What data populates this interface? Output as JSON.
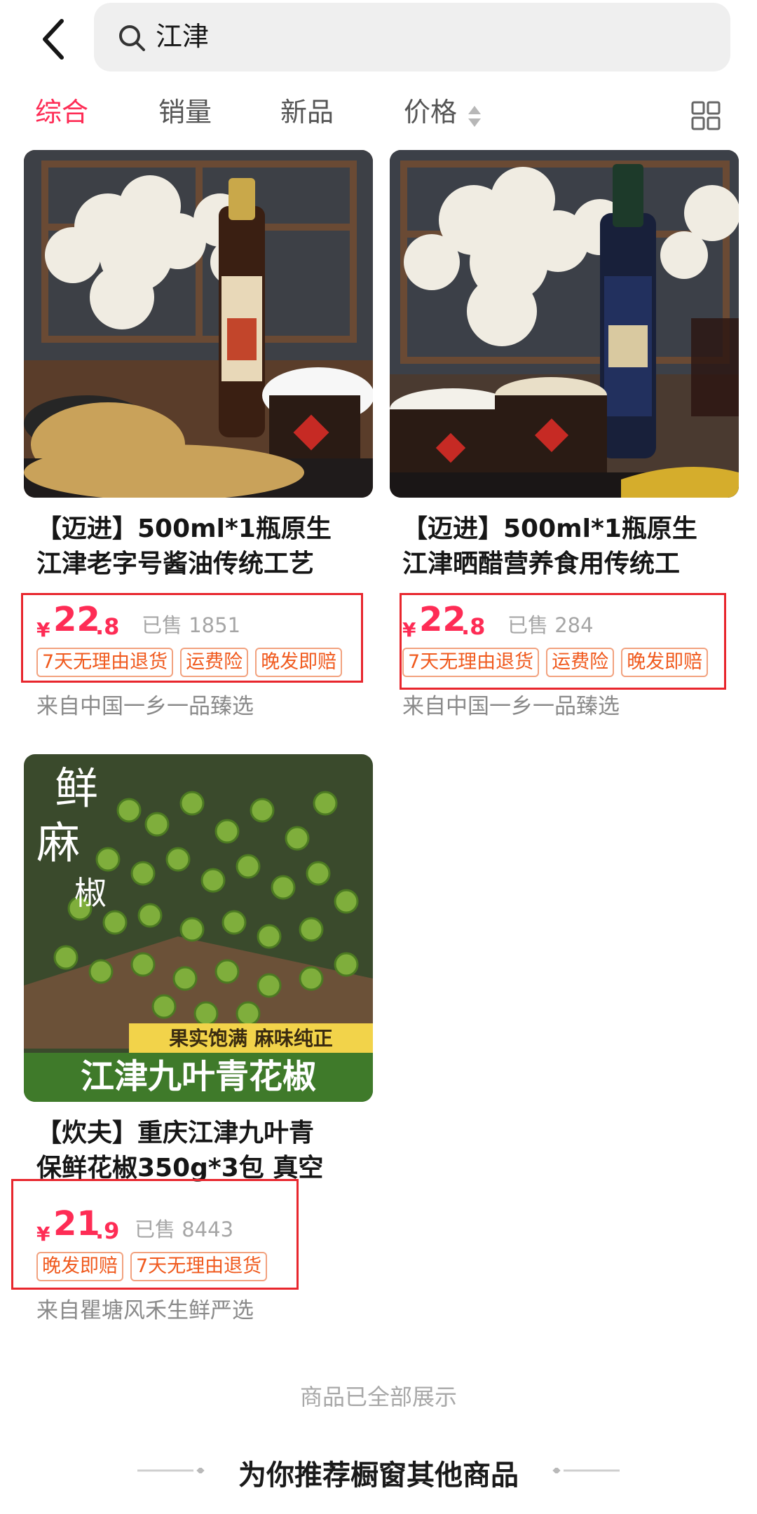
{
  "search": {
    "query": "江津"
  },
  "tabs": [
    {
      "label": "综合",
      "active": true
    },
    {
      "label": "销量",
      "active": false
    },
    {
      "label": "新品",
      "active": false
    },
    {
      "label": "价格",
      "active": false
    }
  ],
  "colors": {
    "accent": "#fe2c55",
    "tag": "#f05a1e",
    "highlight": "#e8262d"
  },
  "products": [
    {
      "title_line1": "【迈进】500ml*1瓶原生",
      "title_line2": "江津老字号酱油传统工艺",
      "currency": "¥",
      "price_int": "22",
      "price_dec": ".8",
      "sold": "已售 1851",
      "tags": [
        "7天无理由退货",
        "运费险",
        "晚发即赔"
      ],
      "shop": "来自中国一乡一品臻选",
      "image_icon": "soy-sauce-bottle-image"
    },
    {
      "title_line1": "【迈进】500ml*1瓶原生",
      "title_line2": "江津晒醋营养食用传统工",
      "currency": "¥",
      "price_int": "22",
      "price_dec": ".8",
      "sold": "已售 284",
      "tags": [
        "7天无理由退货",
        "运费险",
        "晚发即赔"
      ],
      "shop": "来自中国一乡一品臻选",
      "image_icon": "vinegar-bottle-image"
    },
    {
      "title_line1": "【炊夫】重庆江津九叶青",
      "title_line2": "保鲜花椒350g*3包 真空",
      "currency": "¥",
      "price_int": "21",
      "price_dec": ".9",
      "sold": "已售 8443",
      "tags": [
        "晚发即赔",
        "7天无理由退货"
      ],
      "shop": "来自瞿塘风禾生鲜严选",
      "image_icon": "green-peppercorn-image",
      "image_text": {
        "vertical1": "鲜",
        "vertical2": "麻",
        "vertical3": "椒",
        "banner_small": "果实饱满  麻味纯正",
        "banner_big": "江津九叶青花椒"
      }
    }
  ],
  "footer": {
    "all_shown": "商品已全部展示",
    "recommend_title": "为你推荐橱窗其他商品"
  }
}
